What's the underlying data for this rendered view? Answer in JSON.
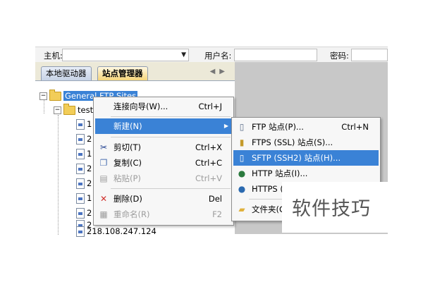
{
  "connection_bar": {
    "host_label": "主机:",
    "user_label": "用户名:",
    "password_label": "密码:"
  },
  "tabs": {
    "local": "本地驱动器",
    "site_manager": "站点管理器"
  },
  "tree": {
    "root_label": "General FTP Sites",
    "child_label": "test",
    "last_item": "218.108.247.124",
    "partial_items": [
      "1",
      "2",
      "1",
      "2",
      "2",
      "1",
      "2",
      "2"
    ]
  },
  "context_menu": {
    "items": [
      {
        "label": "连接向导(W)...",
        "shortcut": "Ctrl+J",
        "icon": "",
        "disabled": false
      },
      {
        "label": "新建(N)",
        "shortcut": "",
        "icon": "",
        "disabled": false,
        "submenu": true
      },
      {
        "label": "剪切(T)",
        "shortcut": "Ctrl+X",
        "icon": "scissors-icon",
        "disabled": false
      },
      {
        "label": "复制(C)",
        "shortcut": "Ctrl+C",
        "icon": "copy-icon",
        "disabled": false
      },
      {
        "label": "粘贴(P)",
        "shortcut": "Ctrl+V",
        "icon": "paste-icon",
        "disabled": true
      },
      {
        "label": "删除(D)",
        "shortcut": "Del",
        "icon": "delete-x-icon",
        "disabled": false
      },
      {
        "label": "重命名(R)",
        "shortcut": "F2",
        "icon": "rename-icon",
        "disabled": true
      }
    ]
  },
  "submenu": {
    "items": [
      {
        "label": "FTP 站点(P)...",
        "shortcut": "Ctrl+N",
        "icon": "ftp-site-icon"
      },
      {
        "label": "FTPS (SSL) 站点(S)...",
        "shortcut": "",
        "icon": "ftps-lock-icon"
      },
      {
        "label": "SFTP (SSH2) 站点(H)...",
        "shortcut": "",
        "icon": "sftp-site-icon"
      },
      {
        "label": "HTTP 站点(I)...",
        "shortcut": "",
        "icon": "http-globe-icon"
      },
      {
        "label": "HTTPS (S",
        "shortcut": "",
        "icon": "https-globe-icon"
      },
      {
        "label": "文件夹(O",
        "shortcut": "",
        "icon": "folder-icon"
      }
    ]
  },
  "watermark": "软件技巧",
  "colors": {
    "highlight": "#3a82d6",
    "folder": "#f2cd58",
    "gray_area": "#c8c8c8"
  }
}
